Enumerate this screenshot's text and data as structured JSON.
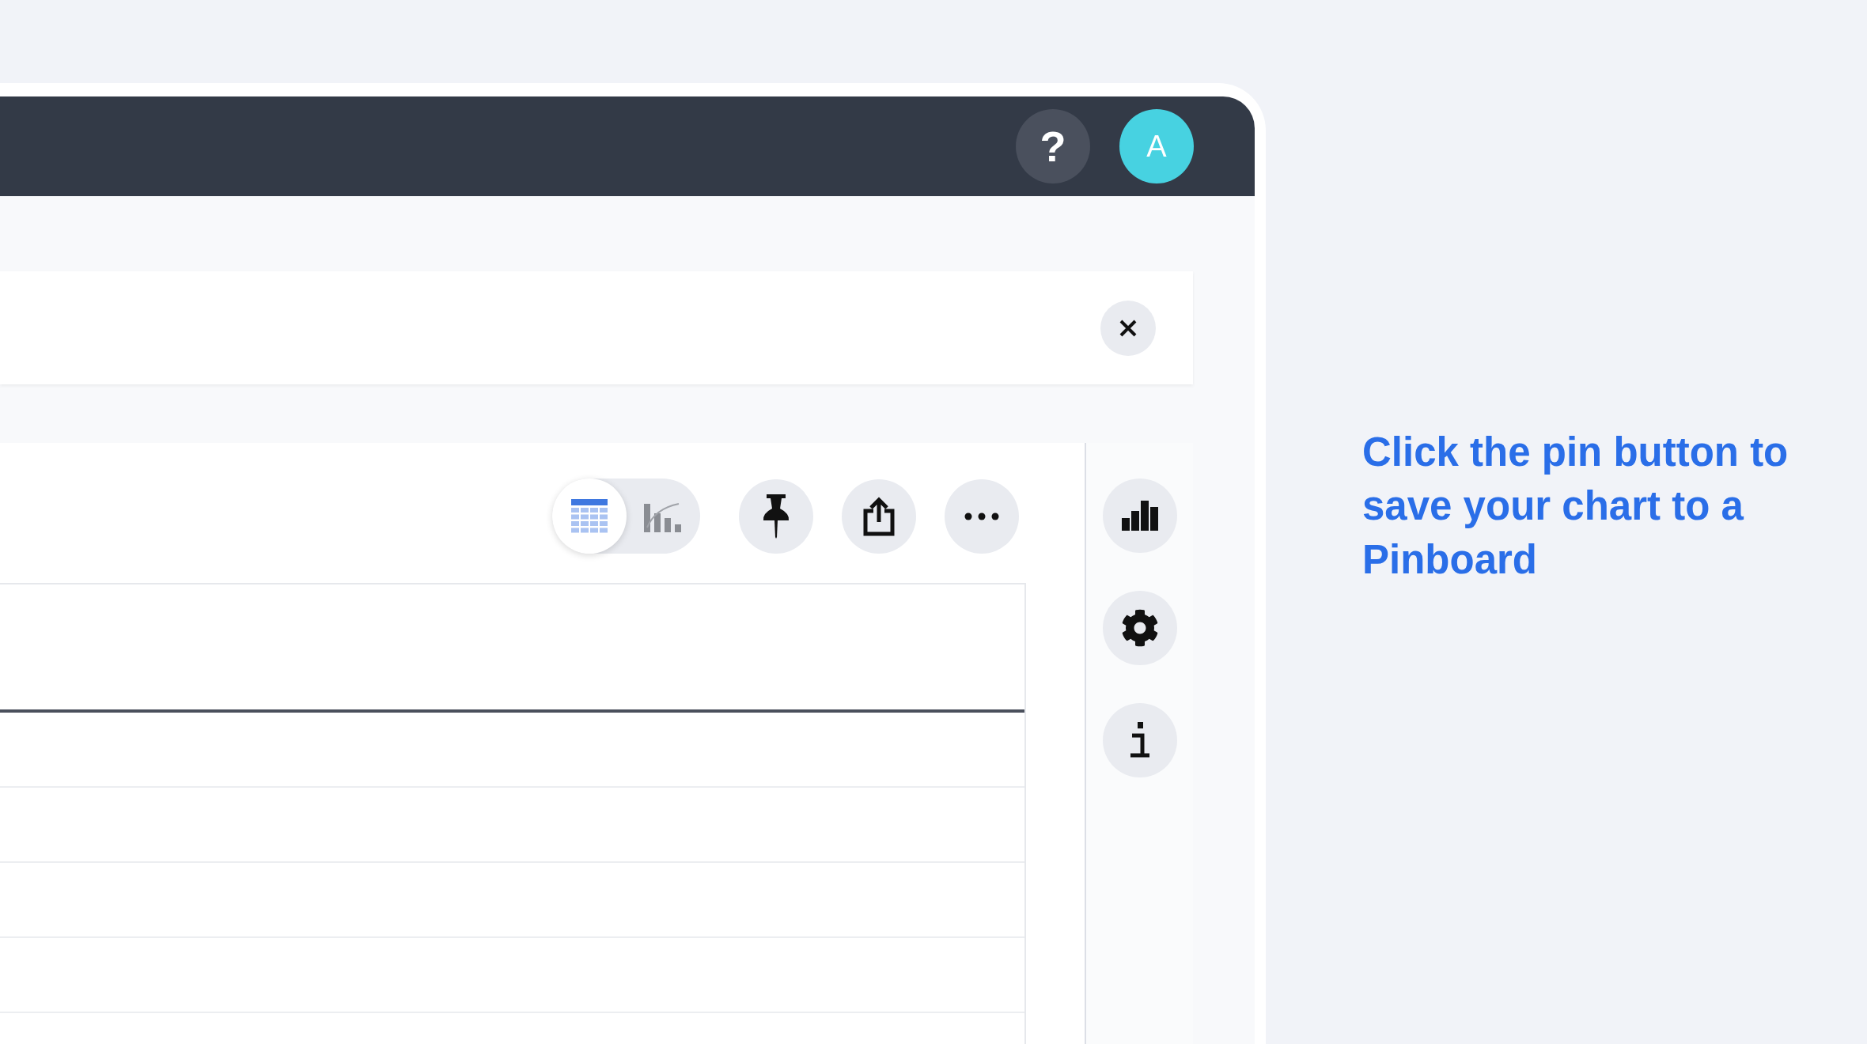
{
  "top_bar": {
    "help_button": "?",
    "avatar": "A"
  },
  "view_toggle": [
    {
      "kind": "table",
      "selected": true
    },
    {
      "kind": "chart",
      "selected": false
    }
  ],
  "caption": "Click the pin button to save your chart to a Pinboard"
}
